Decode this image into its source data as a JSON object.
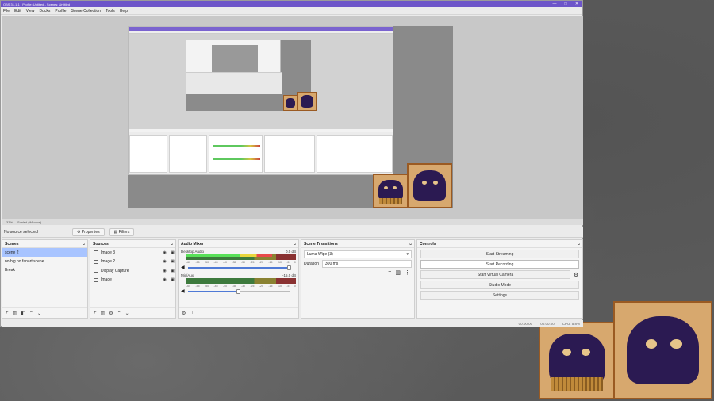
{
  "window": {
    "title": "OBS 31.1.1 - Profile: Untitled - Scenes: Untitled",
    "controls": [
      "—",
      "□",
      "✕"
    ]
  },
  "menu": [
    "File",
    "Edit",
    "View",
    "Docks",
    "Profile",
    "Scene Collection",
    "Tools",
    "Help"
  ],
  "preview_status": {
    "zoom": "33%",
    "scaled": "Scaled (Window)"
  },
  "source_toolbar": {
    "no_source": "No source selected",
    "properties": "Properties",
    "filters": "Filters"
  },
  "scenes": {
    "title": "Scenes",
    "items": [
      "scene 2",
      "no big no fanart scene",
      "Break"
    ]
  },
  "sources": {
    "title": "Sources",
    "items": [
      "Image 3",
      "Image 2",
      "Display Capture",
      "Image"
    ]
  },
  "mixer": {
    "title": "Audio Mixer",
    "channels": [
      {
        "name": "Desktop Audio",
        "db": "0.0 dB",
        "level": 0.78,
        "volume": 1.0
      },
      {
        "name": "Mic/Aux",
        "db": "-15.0 dB",
        "level": 0.0,
        "volume": 0.5
      }
    ],
    "ticks": [
      "-60",
      "-55",
      "-50",
      "-45",
      "-40",
      "-35",
      "-30",
      "-25",
      "-20",
      "-15",
      "-10",
      "-5",
      "0"
    ]
  },
  "transitions": {
    "title": "Scene Transitions",
    "selected": "Luma Wipe (3)",
    "duration_label": "Duration",
    "duration_value": "300 ms"
  },
  "controls": {
    "title": "Controls",
    "start_streaming": "Start Streaming",
    "start_recording": "Start Recording",
    "start_virtual_camera": "Start Virtual Camera",
    "studio_mode": "Studio Mode",
    "settings": "Settings"
  },
  "statusbar": {
    "rec_time": "00:00:00",
    "stream_time": "00:00:00",
    "cpu": "CPU: 5.8%"
  },
  "icons": {
    "gear": "⚙",
    "eye": "👁",
    "lock": "🔒",
    "add": "+",
    "remove": "🗑",
    "up": "⌃",
    "down": "⌄",
    "dots": "⋮",
    "speaker": "🔊",
    "dock_menu": "⧉"
  },
  "colors": {
    "titlebar": "#6d55c9",
    "selected": "#a8c4ff",
    "meter_green": "#59e159"
  }
}
